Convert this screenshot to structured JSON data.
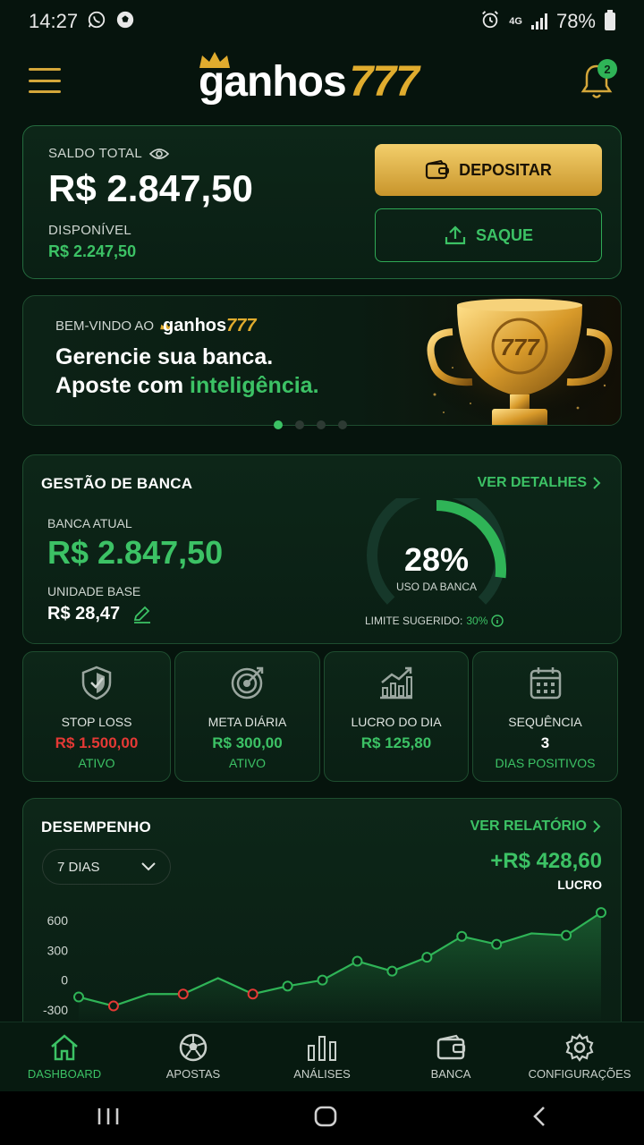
{
  "status": {
    "time": "14:27",
    "network": "4G",
    "battery": "78%"
  },
  "header": {
    "logo_word": "ganhos",
    "logo_num": "777",
    "notif_count": "2"
  },
  "balance": {
    "total_label": "SALDO TOTAL",
    "total_value": "R$ 2.847,50",
    "available_label": "DISPONÍVEL",
    "available_value": "R$ 2.247,50",
    "deposit_label": "DEPOSITAR",
    "withdraw_label": "SAQUE"
  },
  "banner": {
    "welcome": "BEM-VINDO AO",
    "brand_word": "ganhos",
    "brand_num": "777",
    "line1": "Gerencie sua banca.",
    "line2_a": "Aposte com ",
    "line2_b": "inteligência.",
    "trophy_text": "777",
    "active_slide": 0,
    "slide_count": 4
  },
  "gestao": {
    "title": "GESTÃO DE BANCA",
    "link": "VER DETALHES",
    "banca_label": "BANCA ATUAL",
    "banca_value": "R$ 2.847,50",
    "unidade_label": "UNIDADE BASE",
    "unidade_value": "R$ 28,47",
    "usage_pct": 28,
    "usage_text": "28%",
    "usage_label": "USO DA BANCA",
    "limit_label": "LIMITE SUGERIDO:",
    "limit_value": "30%"
  },
  "stats": [
    {
      "title": "STOP LOSS",
      "value": "R$ 1.500,00",
      "sub": "ATIVO",
      "value_color": "#e53935",
      "icon": "shield-icon"
    },
    {
      "title": "META DIÁRIA",
      "value": "R$ 300,00",
      "sub": "ATIVO",
      "value_color": "#3cc265",
      "icon": "target-icon"
    },
    {
      "title": "LUCRO DO DIA",
      "value": "R$ 125,80",
      "sub": "",
      "value_color": "#3cc265",
      "icon": "growth-chart-icon"
    },
    {
      "title": "SEQUÊNCIA",
      "value": "3",
      "sub": "DIAS POSITIVOS",
      "value_color": "#ffffff",
      "icon": "calendar-icon"
    }
  ],
  "desempenho": {
    "title": "DESEMPENHO",
    "link": "VER RELATÓRIO",
    "period": "7 DIAS",
    "profit_value": "+R$ 428,60",
    "profit_label": "LUCRO"
  },
  "chart_data": {
    "type": "area",
    "yticks": [
      600,
      300,
      0,
      -300
    ],
    "ylim": [
      -300,
      600
    ],
    "series": [
      {
        "values": [
          -170,
          -260,
          -140,
          -140,
          20,
          -140,
          -60,
          0,
          190,
          90,
          230,
          440,
          360,
          470,
          450,
          680
        ]
      }
    ],
    "marker_points": [
      0,
      1,
      3,
      5,
      6,
      7,
      8,
      9,
      10,
      11,
      12,
      14,
      15
    ],
    "negative_points": [
      1,
      3,
      5
    ]
  },
  "nav": [
    {
      "label": "DASHBOARD",
      "icon": "home-icon",
      "active": true
    },
    {
      "label": "APOSTAS",
      "icon": "soccer-ball-icon",
      "active": false
    },
    {
      "label": "ANÁLISES",
      "icon": "bar-chart-icon",
      "active": false
    },
    {
      "label": "BANCA",
      "icon": "wallet-icon",
      "active": false
    },
    {
      "label": "CONFIGURAÇÕES",
      "icon": "gear-icon",
      "active": false
    }
  ]
}
